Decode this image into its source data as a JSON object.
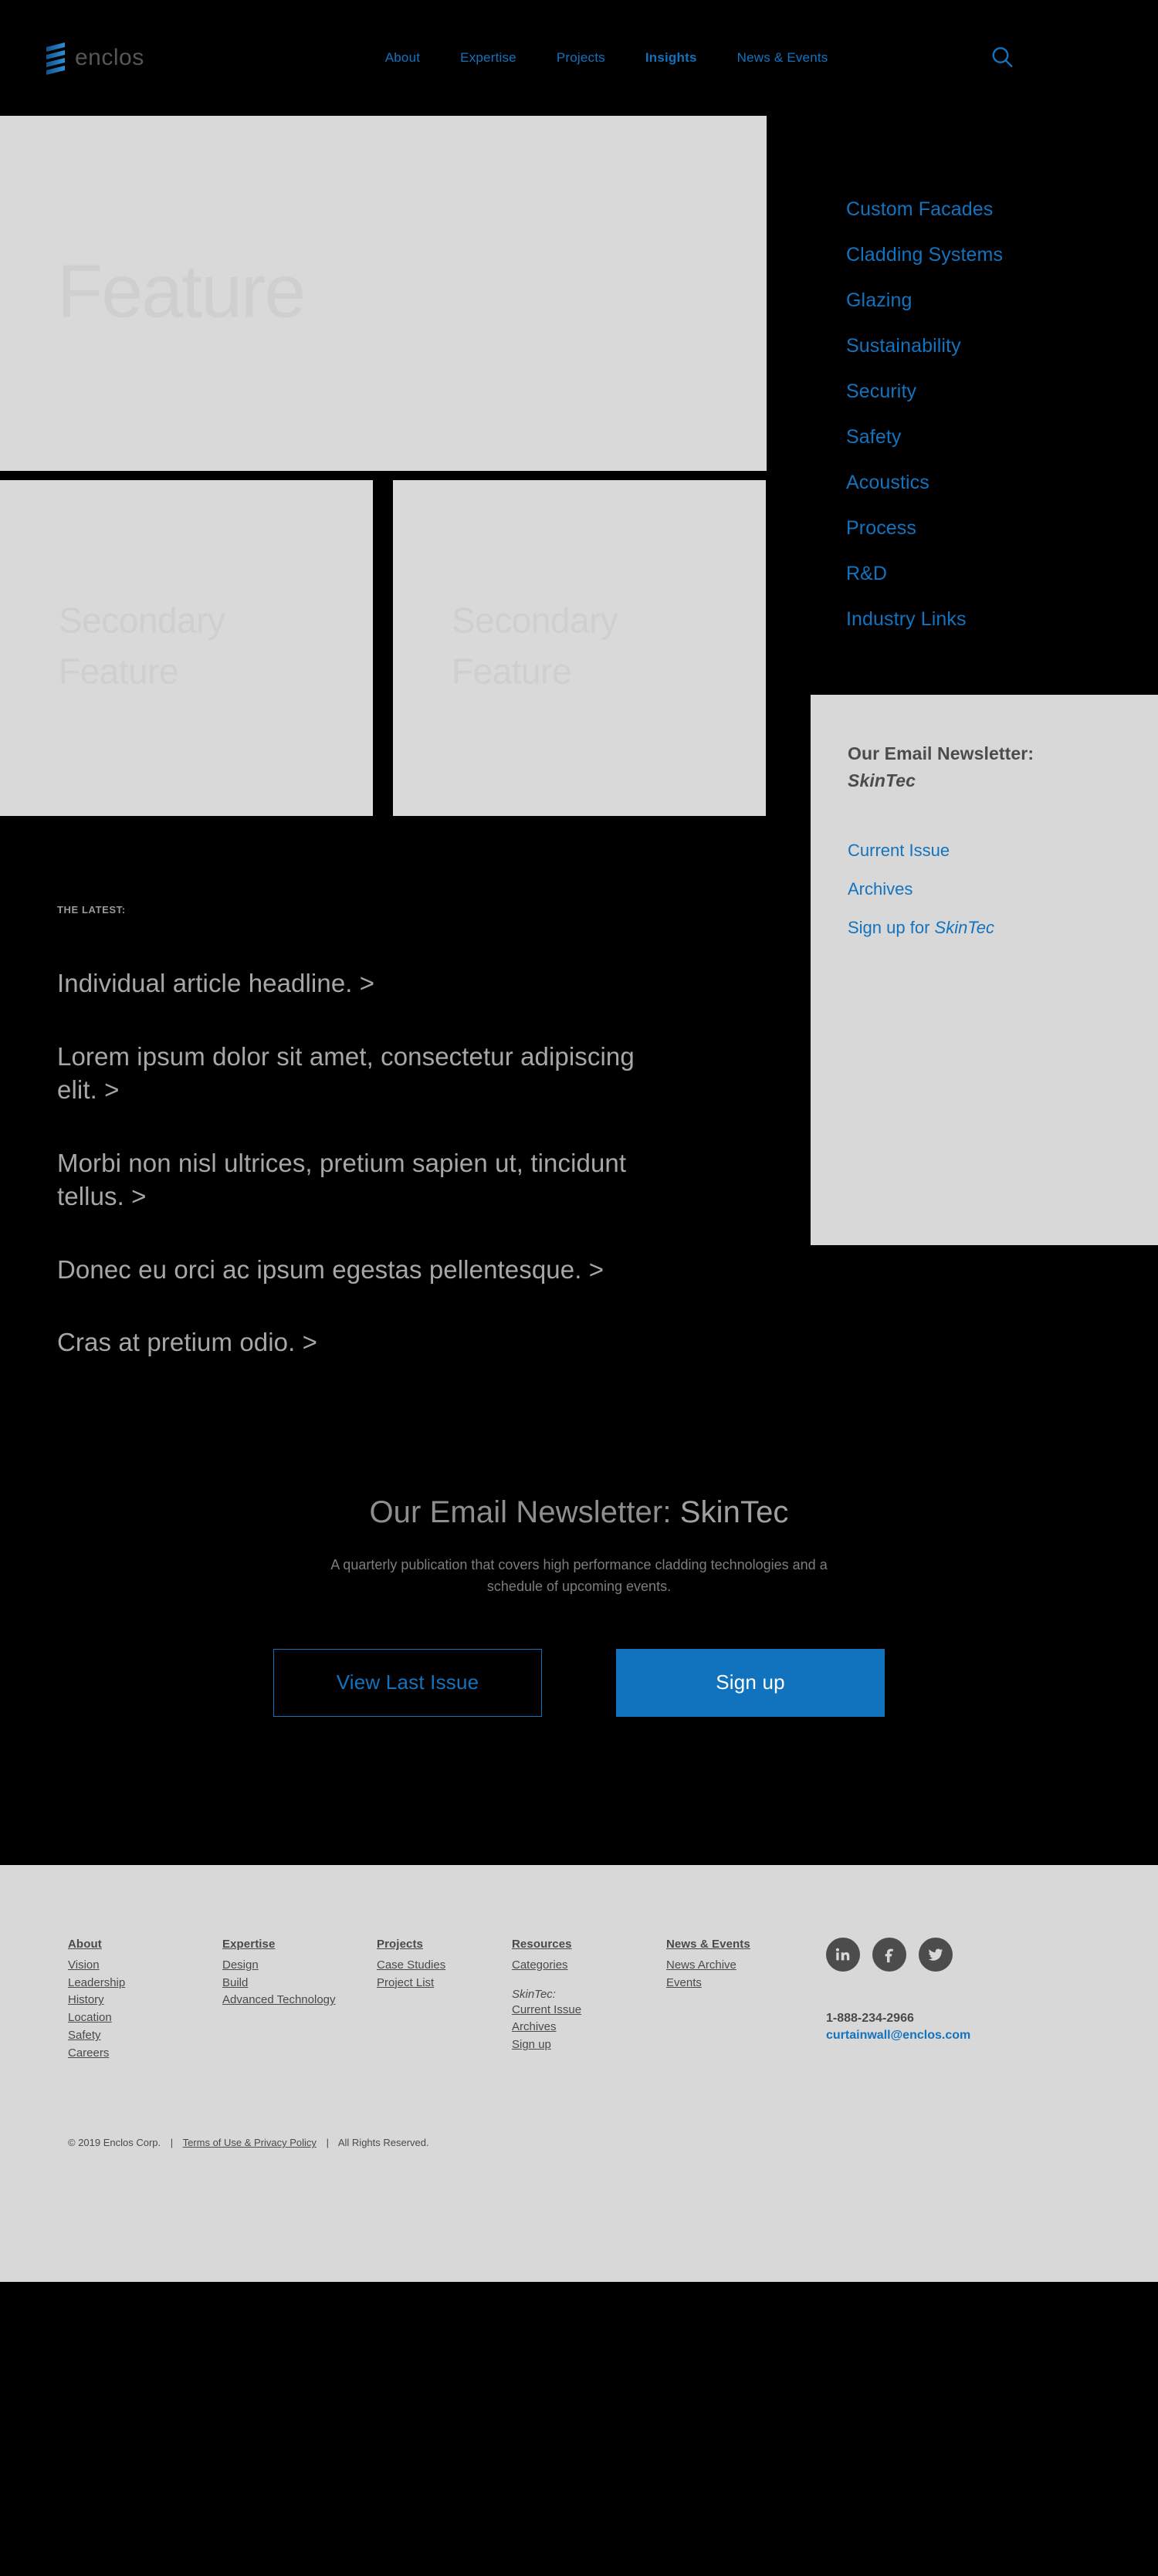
{
  "brand": {
    "logo_word": "enclos",
    "logo_icon": "enclos-slats-logo"
  },
  "header": {
    "nav": [
      {
        "label": "About",
        "active": false
      },
      {
        "label": "Expertise",
        "active": false
      },
      {
        "label": "Projects",
        "active": false
      },
      {
        "label": "Insights",
        "active": true
      },
      {
        "label": "News & Events",
        "active": false
      }
    ],
    "search_icon": "search-icon"
  },
  "hero": {
    "feature_label": "Feature",
    "secondary_label_1": "Secondary\nFeature",
    "secondary_label_2": "Secondary\nFeature"
  },
  "categories": [
    "Custom Facades",
    "Cladding Systems",
    "Glazing",
    "Sustainability",
    "Security",
    "Safety",
    "Acoustics",
    "Process",
    "R&D",
    "Industry Links"
  ],
  "sidebar_newsletter": {
    "title_line1": "Our Email Newsletter:",
    "title_line2": "SkinTec",
    "links": [
      {
        "text": "Current Issue",
        "italic_suffix": ""
      },
      {
        "text": "Archives",
        "italic_suffix": ""
      },
      {
        "text": "Sign up for ",
        "italic_suffix": "SkinTec"
      }
    ]
  },
  "latest": {
    "kicker": "THE LATEST:",
    "items": [
      "Individual article headline. >",
      "Lorem ipsum dolor sit amet, consectetur adipiscing elit. >",
      "Morbi non nisl ultrices, pretium sapien ut, tincidunt tellus. >",
      "Donec eu orci ac ipsum egestas pellentesque. >",
      "Cras at pretium odio. >"
    ]
  },
  "cta": {
    "heading_prefix": "Our Email Newsletter: ",
    "heading_brand": "SkinTec",
    "description": "A quarterly publication that covers high performance cladding technologies and a schedule of upcoming events.",
    "button_outline": "View Last Issue",
    "button_solid": "Sign up"
  },
  "footer": {
    "columns": [
      {
        "heading": "About",
        "links": [
          "Vision",
          "Leadership",
          "History",
          "Location",
          "Safety",
          "Careers"
        ]
      },
      {
        "heading": "Expertise",
        "links": [
          "Design",
          "Build",
          "Advanced Technology"
        ]
      },
      {
        "heading": "Projects",
        "links": [
          "Case Studies",
          "Project List"
        ]
      },
      {
        "heading": "Resources",
        "links": [
          "Categories"
        ],
        "sub_label": "SkinTec:",
        "sub_links": [
          "Current Issue",
          "Archives",
          "Sign up"
        ]
      },
      {
        "heading": "News & Events",
        "links": [
          "News Archive",
          "Events"
        ]
      }
    ],
    "social": [
      {
        "name": "linkedin-icon",
        "glyph": "in"
      },
      {
        "name": "facebook-icon",
        "glyph": "f"
      },
      {
        "name": "twitter-icon",
        "glyph": "bird"
      }
    ],
    "phone": "1-888-234-2966",
    "email": "curtainwall@enclos.com",
    "copyright": "© 2019 Enclos Corp.",
    "terms": "Terms of Use & Privacy Policy",
    "rights": "All Rights Reserved.",
    "separator": "|"
  },
  "colors": {
    "accent_blue": "#1373bf",
    "page_black": "#000000",
    "panel_gray": "#d8d8d8",
    "placeholder_gray": "#d9d9d9",
    "text_gray": "#4a4a4a"
  }
}
